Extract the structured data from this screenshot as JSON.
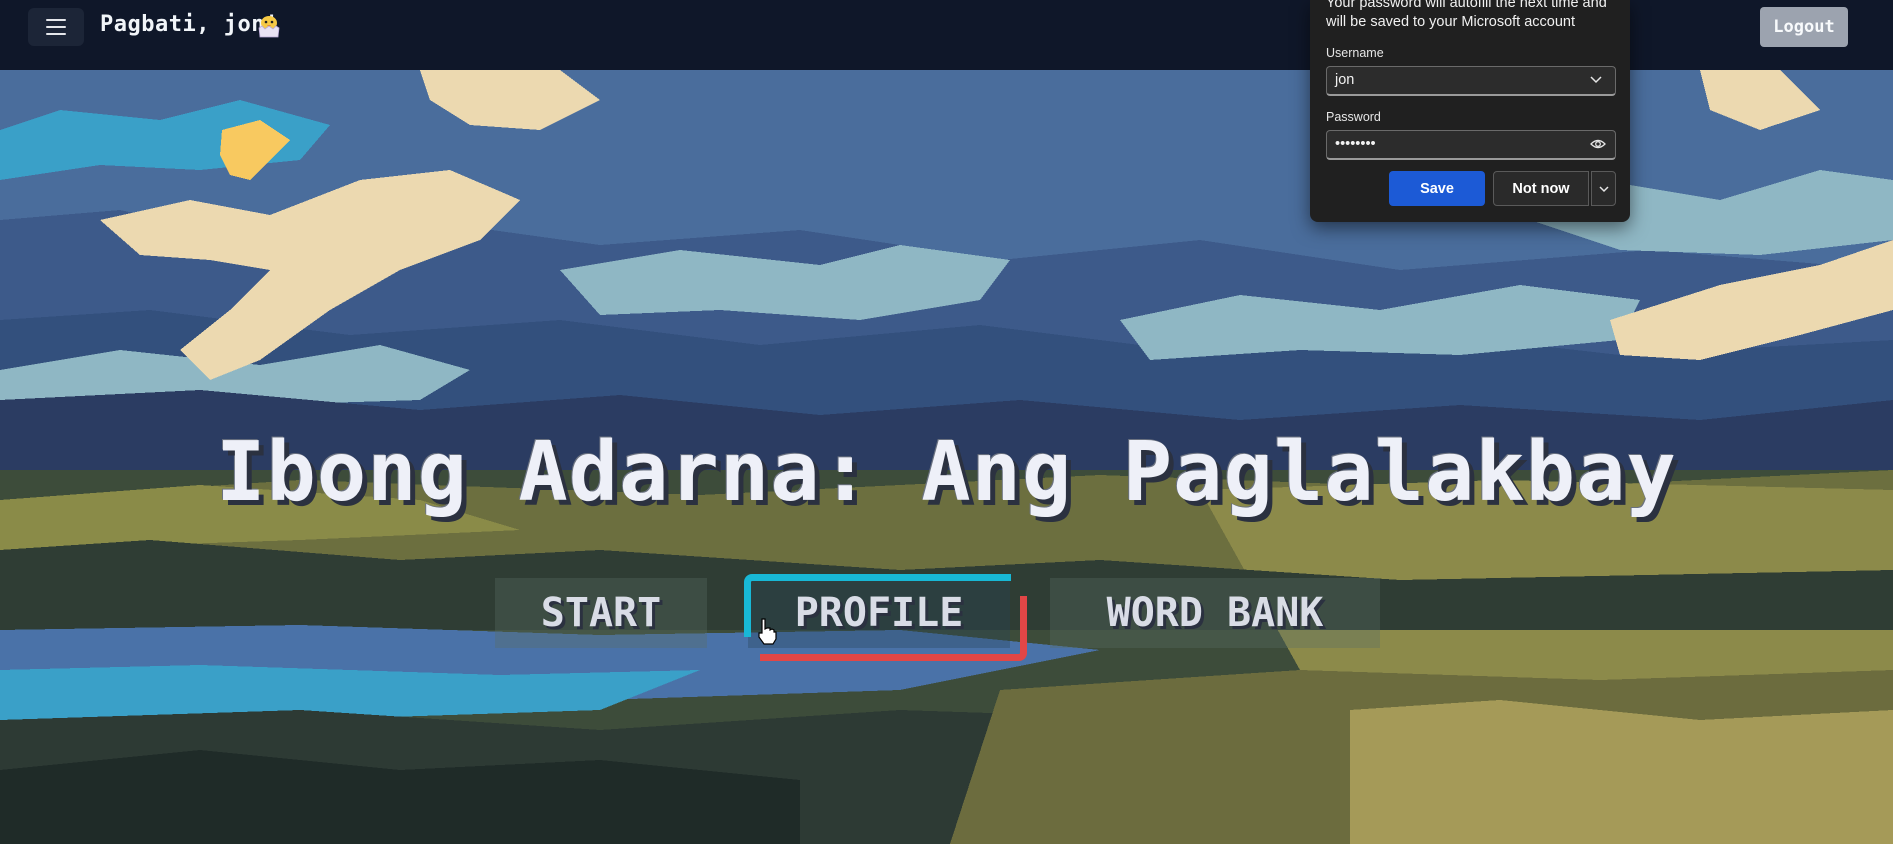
{
  "topbar": {
    "greeting": "Pagbati, jon!",
    "logout_label": "Logout",
    "icons": [
      "hamburger-menu-icon",
      "chick-emoji-icon"
    ]
  },
  "game": {
    "title": "Ibong Adarna: Ang Paglalakbay",
    "buttons": {
      "start": "START",
      "profile": "PROFILE",
      "word_bank": "WORD BANK"
    },
    "selected_button": "PROFILE",
    "selection_colors": {
      "top_left": "#18b8d6",
      "bottom_right": "#e24646"
    }
  },
  "password_prompt": {
    "message": "Your password will autofill the next time and will be saved to your Microsoft account",
    "username_label": "Username",
    "username_value": "jon",
    "password_label": "Password",
    "password_value": "••••••••",
    "save_label": "Save",
    "not_now_label": "Not now",
    "save_color": "#1c5ad6"
  }
}
